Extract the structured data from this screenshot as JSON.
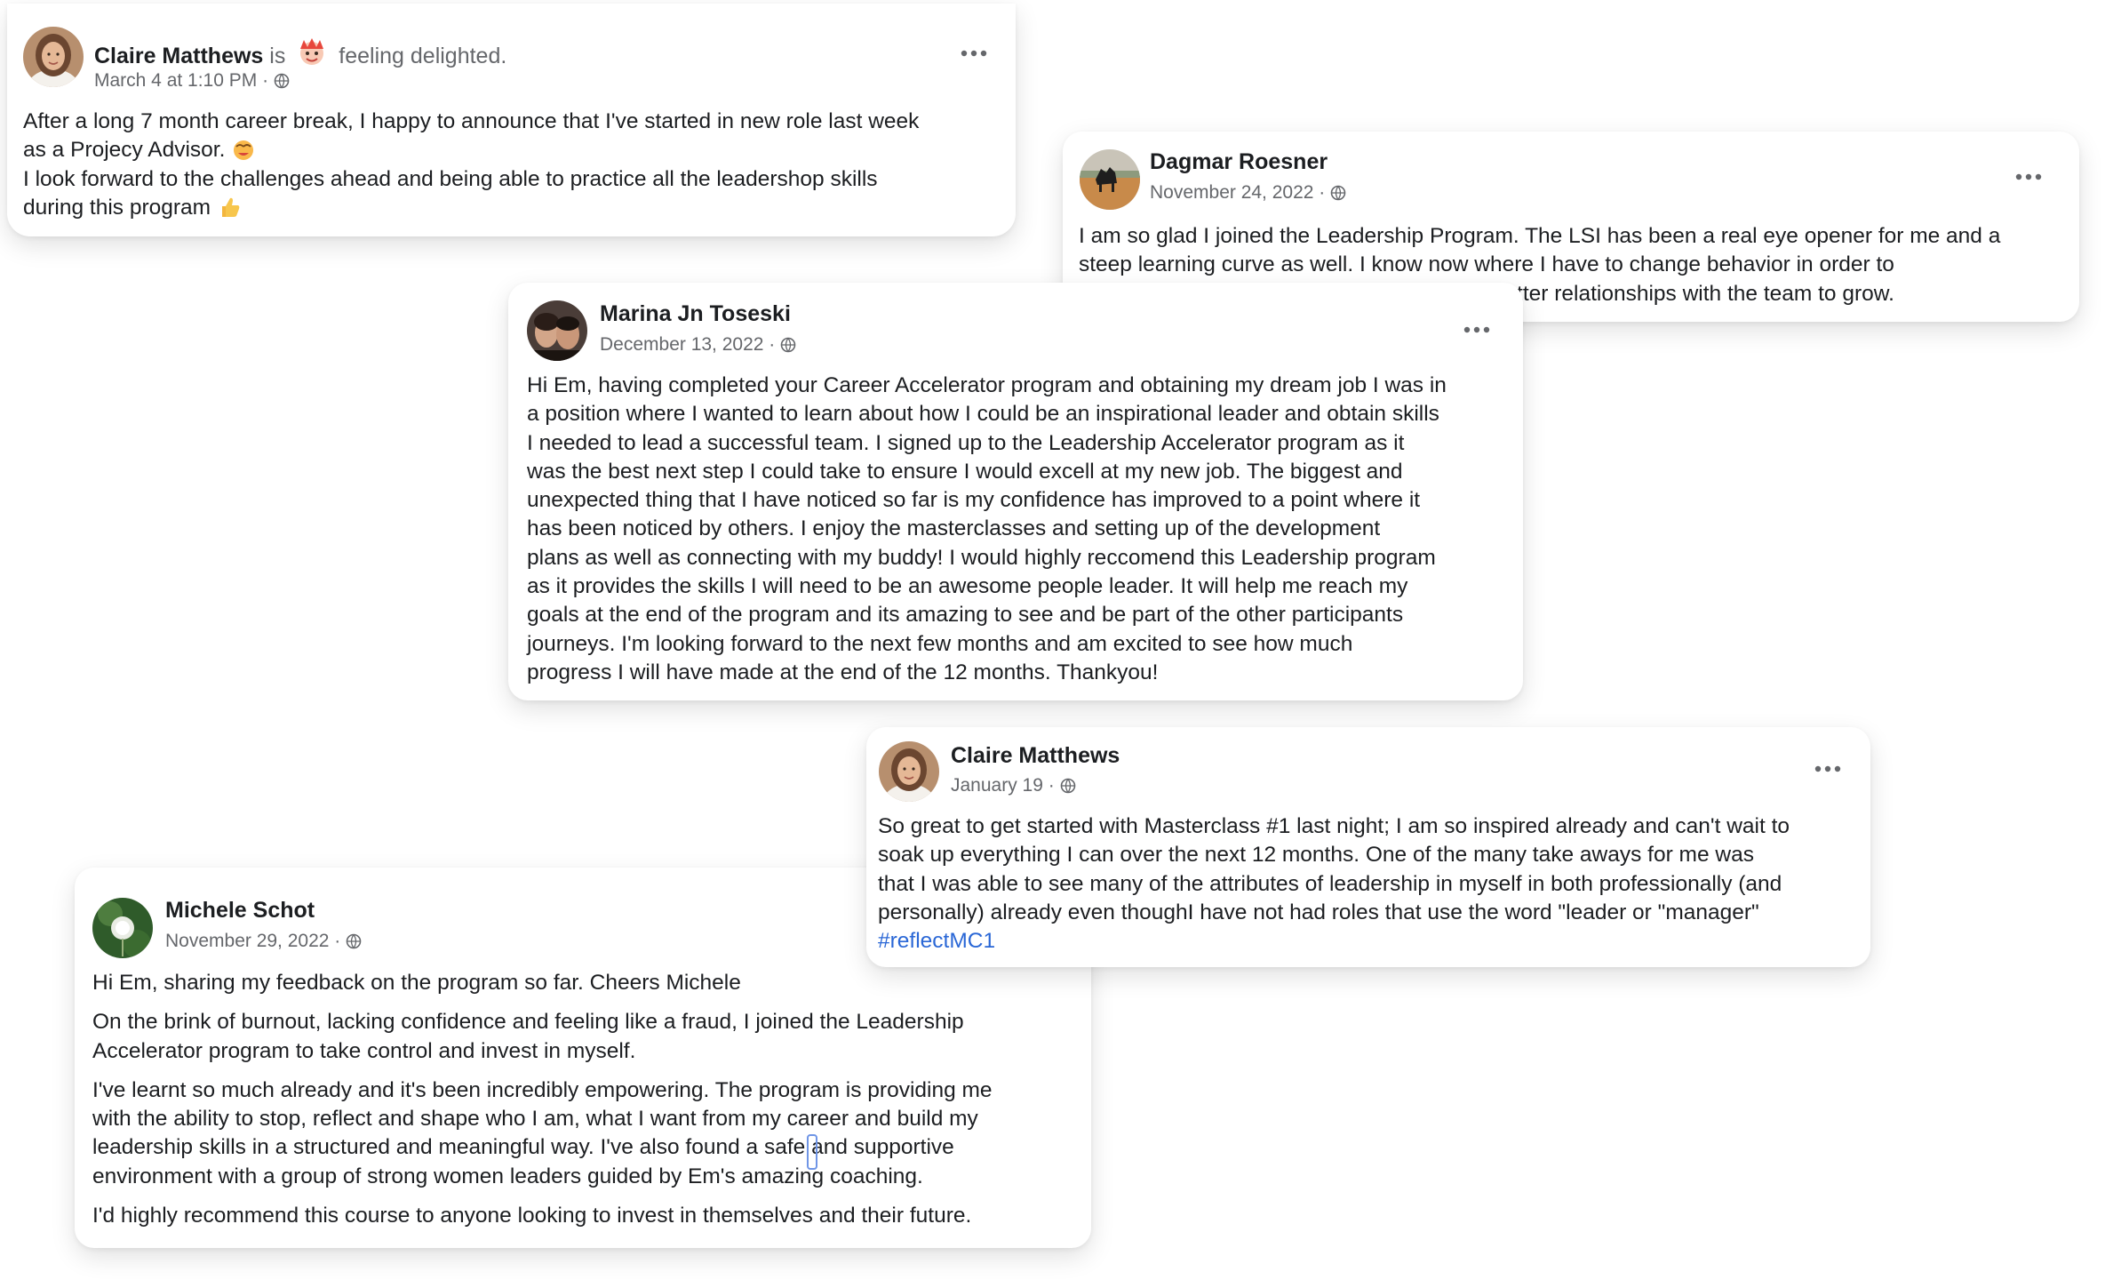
{
  "posts": [
    {
      "author": "Claire Matthews",
      "is_word": "is",
      "feeling": "feeling delighted.",
      "feeling_emoji": "delighted-emoji",
      "timestamp": "March 4 at 1:10 PM ·",
      "privacy_icon": "globe-icon",
      "lines": [
        "After a long 7 month career break, I happy to announce that I've started in new role last week",
        "as a Projecy Advisor.",
        "I look forward to the challenges ahead and being able to practice all the leadershop skills",
        "during this program"
      ],
      "inline_emojis": [
        "hot-face-emoji",
        "thumbs-up-emoji"
      ]
    },
    {
      "author": "Dagmar Roesner",
      "timestamp": "November 24, 2022 ·",
      "privacy_icon": "globe-icon",
      "lines": [
        "I am so glad I joined the Leadership Program. The LSI has been a real eye opener for me and a",
        "steep learning curve as well. I know now where I have to change behavior in order to",
        "demonstrate leadership qualities and build better relationships with the team to grow."
      ]
    },
    {
      "author": "Marina Jn Toseski",
      "timestamp": "December 13, 2022 ·",
      "privacy_icon": "globe-icon",
      "lines": [
        "Hi Em, having completed your Career Accelerator program and obtaining my dream job I was in",
        "a position where I wanted to learn about how I could be an inspirational leader and obtain skills",
        "I needed to lead a successful team.  I signed up to the Leadership Accelerator program as it",
        "was the best next step I could take to ensure I would excell at my new job.  The biggest and",
        "unexpected thing that I have noticed so far is my confidence has improved to a point where it",
        "has been noticed by others.  I enjoy the masterclasses and setting up of the development",
        "plans as well as connecting with my buddy! I would highly reccomend this Leadership program",
        "as it provides the skills I will need to be an awesome people leader. It will help me reach my",
        "goals at the end of the program and its amazing to see and be part of the other participants",
        "journeys.  I'm looking forward to the next few months and am excited to see how much",
        "progress I will have made at the end of the 12 months. Thankyou!"
      ]
    },
    {
      "author": "Claire Matthews",
      "timestamp": "January 19 ·",
      "privacy_icon": "globe-icon",
      "lines": [
        "So great to get started with Masterclass #1 last night; I am so inspired already and can't wait to",
        "soak up everything I can over the next 12 months.  One of the many take aways for me was",
        "that I  was able to see many of the attributes of leadership in myself in both professionally (and",
        "personally)  already even thoughI have not had roles that use the word \"leader or \"manager\""
      ],
      "hashtag": "#reflectMC1"
    },
    {
      "author": "Michele Schot",
      "timestamp": "November 29, 2022 ·",
      "privacy_icon": "globe-icon",
      "paragraphs": [
        [
          "Hi Em, sharing my feedback on the program so far. Cheers Michele"
        ],
        [
          "On the brink of burnout, lacking confidence and feeling like a fraud, I joined the Leadership",
          "Accelerator program to take control and invest in myself."
        ],
        [
          "I've learnt so much already and it's been incredibly empowering. The program is providing me",
          "with the ability to stop, reflect and shape who I am, what I want from my career and build my",
          "leadership skills in a structured and meaningful way.  I've also found a safe and supportive",
          "environment with a group of strong women leaders guided by Em's amazing coaching."
        ],
        [
          "I'd highly recommend this course to anyone looking to invest in themselves and their future."
        ]
      ]
    }
  ],
  "more_icon": "more-options-icon"
}
